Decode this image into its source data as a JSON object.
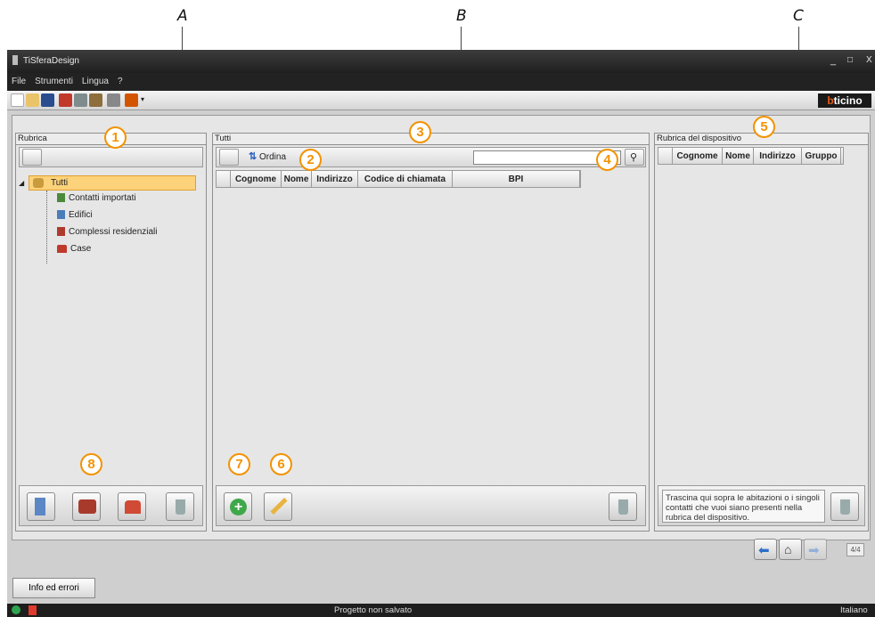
{
  "annotations": {
    "letters": [
      "A",
      "B",
      "C"
    ],
    "callouts": [
      "1",
      "2",
      "3",
      "4",
      "5",
      "6",
      "7",
      "8"
    ]
  },
  "window": {
    "title": "TiSferaDesign",
    "controls": [
      "_",
      "□",
      "X"
    ]
  },
  "menu": [
    "File",
    "Strumenti",
    "Lingua",
    "?"
  ],
  "brand": {
    "prefix": "b",
    "rest": "ticino"
  },
  "rubrica": {
    "title": "Rubrica",
    "tree": {
      "root": "Tutti",
      "children": [
        "Contatti importati",
        "Edifici",
        "Complessi residenziali",
        "Case"
      ]
    }
  },
  "tutti": {
    "title": "Tutti",
    "sort_label": "Ordina",
    "search_value": "",
    "columns": [
      "Cognome",
      "Nome",
      "Indirizzo",
      "Codice di chiamata",
      "BPI"
    ]
  },
  "device": {
    "title": "Rubrica del dispositivo",
    "columns": [
      "Cognome",
      "Nome",
      "Indirizzo",
      "Gruppo"
    ],
    "hint": "Trascina qui sopra le abitazioni o i singoli contatti che vuoi siano presenti nella rubrica del dispositivo."
  },
  "nav": {
    "page": "4/4"
  },
  "info_button": "Info ed errori",
  "status": {
    "center": "Progetto non salvato",
    "right": "Italiano"
  }
}
